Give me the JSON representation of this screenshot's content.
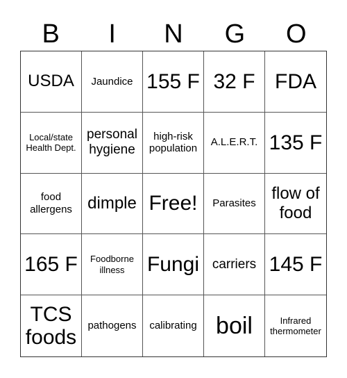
{
  "header": {
    "letters": [
      "B",
      "I",
      "N",
      "G",
      "O"
    ]
  },
  "cells": [
    "USDA",
    "Jaundice",
    "155 F",
    "32 F",
    "FDA",
    "Local/state Health Dept.",
    "personal hygiene",
    "high-risk population",
    "A.L.E.R.T.",
    "135 F",
    "food allergens",
    "dimple",
    "Free!",
    "Parasites",
    "flow of food",
    "165 F",
    "Foodborne illness",
    "Fungi",
    "carriers",
    "145 F",
    "TCS foods",
    "pathogens",
    "calibrating",
    "boil",
    "Infrared thermometer"
  ]
}
